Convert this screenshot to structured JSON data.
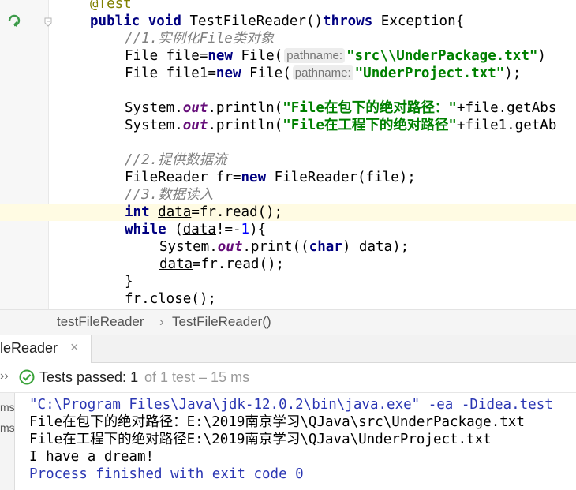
{
  "editor": {
    "lines": {
      "annotation": "@Test",
      "signature": {
        "kw1": "public",
        "kw2": "void",
        "name": " TestFileReader()",
        "kw3": "throws",
        "rest": " Exception{"
      },
      "comment1": "//1.实例化File类对象",
      "file_decl": {
        "prefix": "File file=",
        "kw": "new",
        "call": " File(",
        "hint": "pathname:",
        "str": "\"src\\\\UnderPackage.txt\"",
        "end": ")"
      },
      "file1_decl": {
        "prefix": "File file1=",
        "kw": "new",
        "call": " File(",
        "hint": "pathname:",
        "str": "\"UnderProject.txt\"",
        "end": ");"
      },
      "println1": {
        "a": "System.",
        "out": "out",
        "b": ".println(",
        "str": "\"File在包下的绝对路径：\"",
        "c": "+file.getAbs"
      },
      "println2": {
        "a": "System.",
        "out": "out",
        "b": ".println(",
        "str": "\"File在工程下的绝对路径\"",
        "c": "+file1.getAb"
      },
      "comment2": "//2.提供数据流",
      "reader_decl": {
        "a": "FileReader fr=",
        "kw": "new",
        "b": " FileReader(file);"
      },
      "comment3": "//3.数据读入",
      "int_line": {
        "kw": "int",
        "sp": " ",
        "var": "data",
        "rest": "=fr.read();"
      },
      "while_line": {
        "kw": "while",
        "a": " (",
        "var": "data",
        "b": "!=-",
        "num": "1",
        "c": "){"
      },
      "print_line": {
        "a": "System.",
        "out": "out",
        "b": ".print((",
        "kw": "char",
        "c": ") ",
        "var": "data",
        "d": ");"
      },
      "read_line": {
        "var": "data",
        "rest": "=fr.read();"
      },
      "close_brace": "}",
      "close_line": "fr.close();"
    }
  },
  "breadcrumb": {
    "item1": "testFileReader",
    "sep": "›",
    "item2": "TestFileReader()"
  },
  "run_tab": {
    "label": "leReader",
    "close": "×"
  },
  "status": {
    "chevron": "››",
    "passed_label": "Tests passed:",
    "passed_count": "1",
    "rest": "of 1 test – 15 ms"
  },
  "console": {
    "side_labels": [
      "ms",
      "ms"
    ],
    "lines": [
      "\"C:\\Program Files\\Java\\jdk-12.0.2\\bin\\java.exe\" -ea -Didea.test",
      "File在包下的绝对路径：E:\\2019南京学习\\QJava\\src\\UnderPackage.txt",
      "File在工程下的绝对路径E:\\2019南京学习\\QJava\\UnderProject.txt",
      "I have a dream!",
      "Process finished with exit code 0"
    ]
  },
  "colors": {
    "keyword": "#000080",
    "string": "#008000",
    "comment": "#808080",
    "field": "#660e7a",
    "number": "#0000ff",
    "pass": "#3aa33a"
  }
}
